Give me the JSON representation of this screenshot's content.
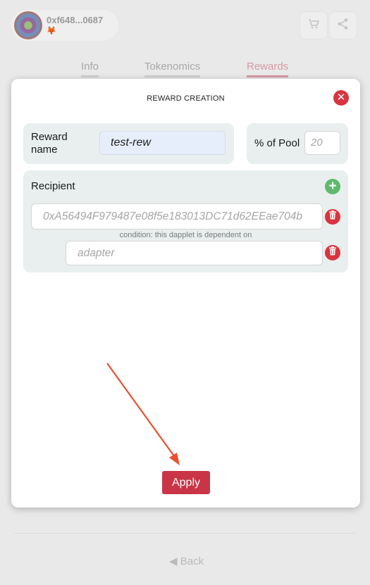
{
  "header": {
    "account_address": "0xf648...0687",
    "wallet_icon": "metamask-fox-icon",
    "cart_icon": "cart-icon",
    "share_icon": "share-icon"
  },
  "tabs": [
    {
      "label": "Info",
      "active": false
    },
    {
      "label": "Tokenomics",
      "active": false
    },
    {
      "label": "Rewards",
      "active": true
    }
  ],
  "modal": {
    "title": "REWARD CREATION",
    "close_icon": "close-icon",
    "reward_name": {
      "label": "Reward name",
      "value": "test-rew"
    },
    "pool": {
      "label": "% of Pool",
      "placeholder": "20"
    },
    "recipient": {
      "label": "Recipient",
      "add_icon": "plus-icon",
      "address_placeholder": "0xA56494F979487e08f5e183013DC71d62EEae704b",
      "condition_text": "condition: this dapplet is dependent on",
      "condition_placeholder": "adapter",
      "delete_icon": "trash-icon"
    },
    "apply_label": "Apply"
  },
  "footer": {
    "back_label": "Back"
  },
  "colors": {
    "accent_red": "#c93547",
    "add_green": "#5eb96c",
    "panel_bg": "#e9eeee",
    "annotation_arrow": "#e8502f"
  }
}
